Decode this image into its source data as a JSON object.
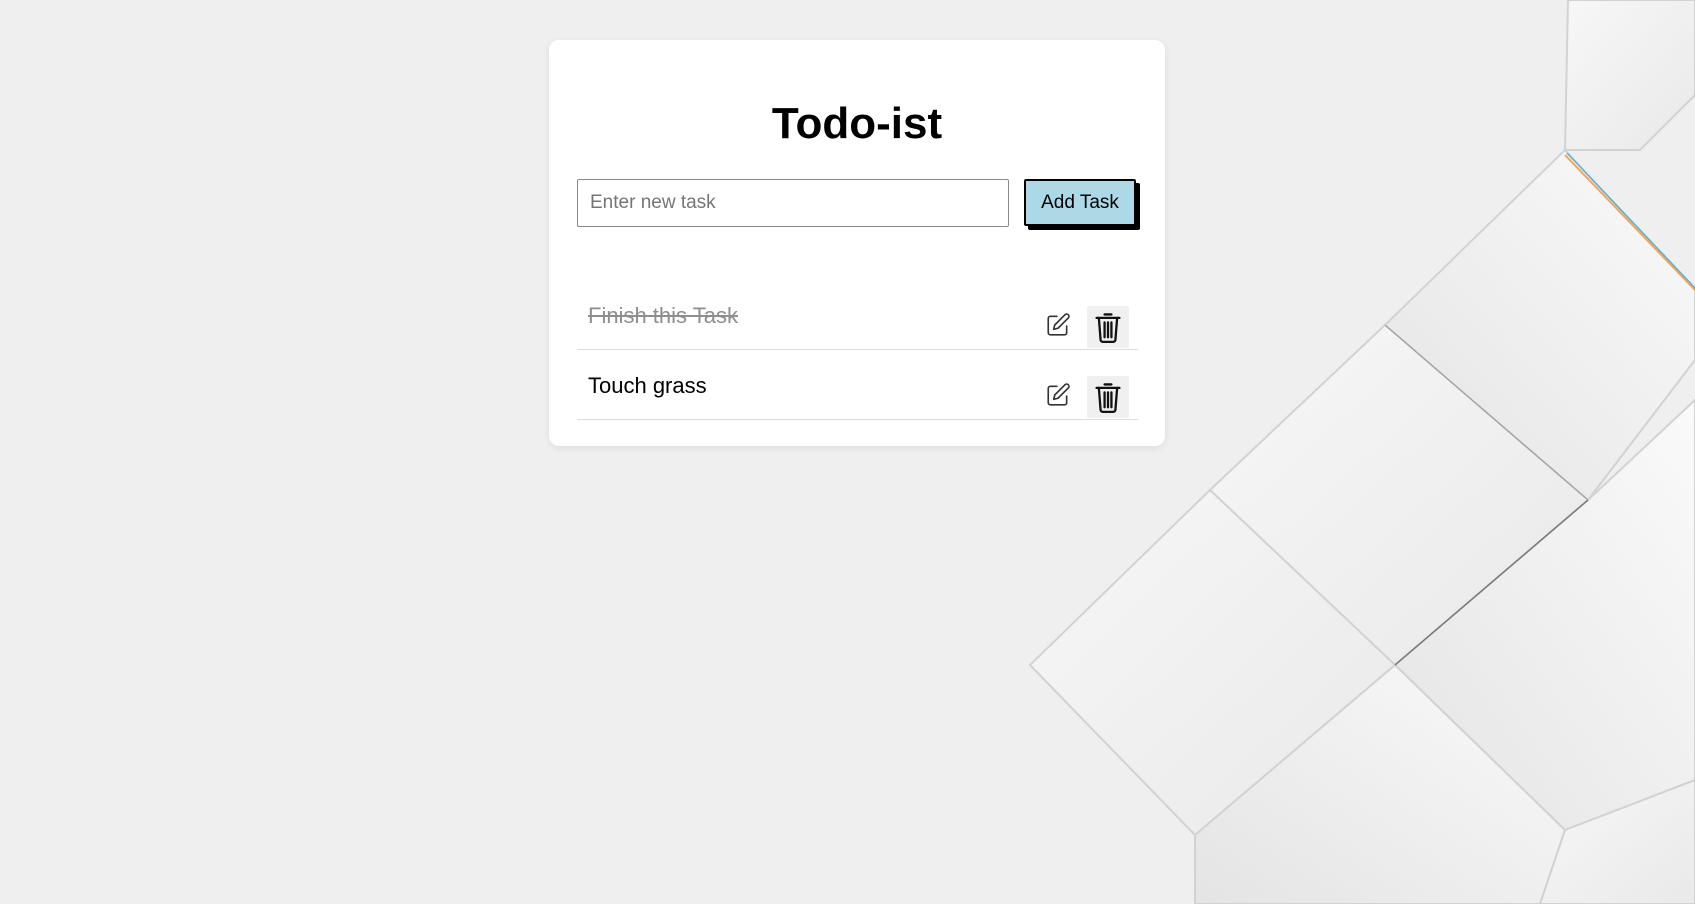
{
  "app": {
    "title": "Todo-ist"
  },
  "new_task": {
    "placeholder": "Enter new task",
    "value": "",
    "add_label": "Add Task"
  },
  "tasks": [
    {
      "text": "Finish this Task",
      "completed": true
    },
    {
      "text": "Touch grass",
      "completed": false
    }
  ],
  "colors": {
    "page_background": "#efefef",
    "card_background": "#ffffff",
    "add_button": "#add8e6",
    "completed_text": "#8e8e8e"
  },
  "icons": {
    "edit": "edit-icon",
    "delete": "trash-icon"
  }
}
